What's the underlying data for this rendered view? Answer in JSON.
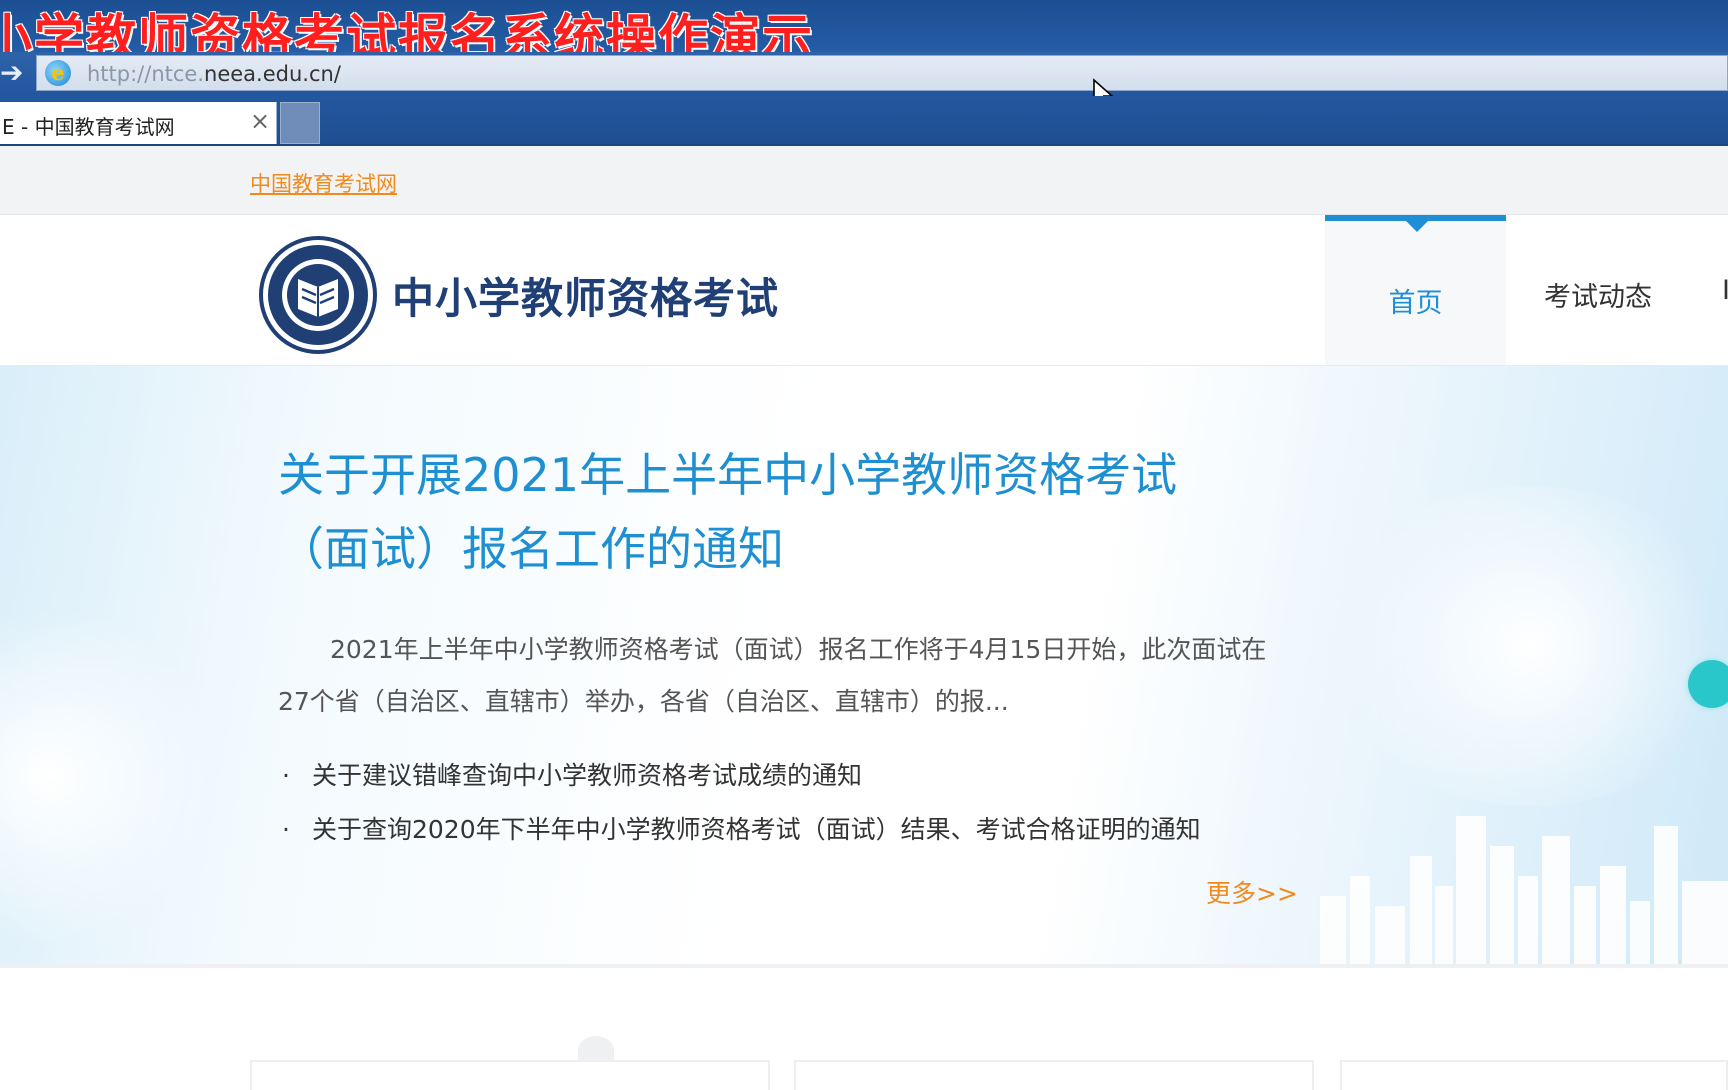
{
  "video_caption": "小学教师资格考试报名系统操作演示",
  "browser": {
    "url_protocol": "http://ntce.",
    "url_host": "neea.edu.cn/",
    "tab_title": "E - 中国教育考试网",
    "tab_close": "×",
    "back_glyph": "➔",
    "icons": [
      "ie-icon",
      "back-arrow-icon",
      "close-icon",
      "cursor-icon"
    ]
  },
  "site": {
    "top_link": "中国教育考试网",
    "title": "中小学教师资格考试",
    "nav": {
      "home": "首页",
      "item2": "考试动态",
      "item3": "I"
    },
    "accent_color": "#1e8fd6",
    "link_color": "#f08a1c"
  },
  "hero": {
    "headline": "关于开展2021年上半年中小学教师资格考试（面试）报名工作的通知",
    "summary": "2021年上半年中小学教师资格考试（面试）报名工作将于4月15日开始，此次面试在27个省（自治区、直辖市）举办，各省（自治区、直辖市）的报...",
    "news": [
      "关于建议错峰查询中小学教师资格考试成绩的通知",
      "关于查询2020年下半年中小学教师资格考试（面试）结果、考试合格证明的通知"
    ],
    "bullet": "·",
    "more": "更多>>"
  }
}
